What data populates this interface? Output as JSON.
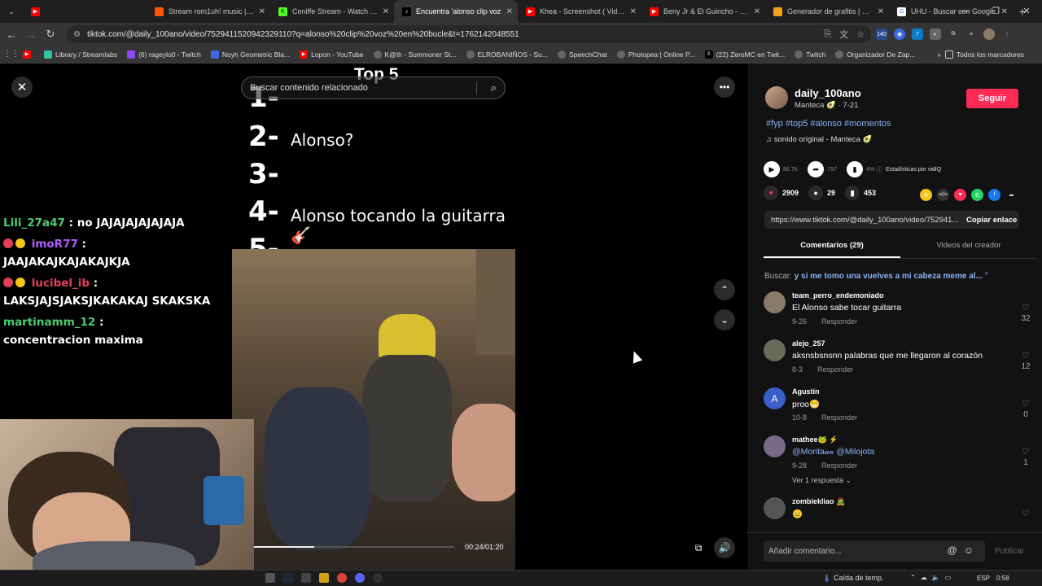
{
  "browser": {
    "tabs": [
      {
        "label": "Stream rom1uh! music | Listen",
        "color": "#ff5500"
      },
      {
        "label": "Ceniffe Stream - Watch Live on",
        "color": "#53fc18"
      },
      {
        "label": "Encuentra 'alonso clip voz",
        "color": "#000000"
      },
      {
        "label": "Khea - Screenshot ( Video Ofi",
        "color": "#ff0000"
      },
      {
        "label": "Beny Jr & El Guincho - Comba",
        "color": "#ff0000"
      },
      {
        "label": "Generador de grafitis | Genera",
        "color": "#f4a020"
      },
      {
        "label": "UHU - Buscar con Google",
        "color": "#4285f4"
      }
    ],
    "url": "tiktok.com/@daily_100ano/video/7529411520942329110?q=alonso%20clip%20voz%20en%20bucle&t=1762142048551",
    "bookmarks": [
      "Library / Streamlabs",
      "(6) rageylo0 - Twitch",
      "Noyh Geometric Bla...",
      "Lopon - YouTube",
      "K@th - Summoner St...",
      "ELROBANIÑOS - Su...",
      "SpeechChat",
      "Photopea | Online P...",
      "(22) ZeroMC en Twit...",
      "Twitch",
      "Organizador De Zap..."
    ],
    "all_bookmarks": "Todos los marcadores",
    "extension_badge": "140"
  },
  "chat": [
    {
      "user": "Lili_27a47",
      "color": "#4ecb71",
      "msg": "no JAJAJAJAJAJAJA",
      "badges": []
    },
    {
      "user": "imoR77",
      "color": "#b05cff",
      "msg": "JAAJAKAJKAJAKAJKJA",
      "badges": [
        "#f5c518"
      ]
    },
    {
      "user": "lucibel_ib",
      "color": "#e0415a",
      "msg": "LAKSJAJSJAKSJKAKAKAJ SKAKSKA",
      "badges": [
        "#f5c518"
      ]
    },
    {
      "user": "martinamm_12",
      "color": "#4ecb71",
      "msg": "concentracion maxima",
      "badges": []
    }
  ],
  "video": {
    "search_placeholder": "Buscar contenido relacionado",
    "title": "Top 5",
    "ranks": [
      {
        "n": "1-",
        "text": ""
      },
      {
        "n": "2-",
        "text": "Alonso?"
      },
      {
        "n": "3-",
        "text": ""
      },
      {
        "n": "4-",
        "text": "Alonso tocando la guitarra 🎸"
      },
      {
        "n": "5-",
        "text": ""
      }
    ],
    "time": "00:24/01:20",
    "progress": 0.3
  },
  "sidebar": {
    "author": "daily_100ano",
    "meta": "Manteca 🥑 · 7-21",
    "follow": "Seguir",
    "hashtags": "#fyp #top5 #alonso #momentos",
    "music": "♫  sonido original - Manteca 🥑",
    "plays": "86.7K",
    "shares": "797",
    "pct": "4%",
    "vidiq": "Estadísticas por vidIQ",
    "likes": "2909",
    "comments": "29",
    "saves": "453",
    "link": "https://www.tiktok.com/@daily_100ano/video/7529411520942329110",
    "copy": "Copiar enlace",
    "tab_comments": "Comentarios (29)",
    "tab_videos": "Videos del creador",
    "search_label": "Buscar:",
    "search_query": "y si me tomo una vuelves a mi cabeza meme al...",
    "comments_list": [
      {
        "name": "team_perro_endemoniado",
        "text": "El Alonso sabe tocar guitarra",
        "date": "9-26",
        "reply": "Responder",
        "likes": "32",
        "avatar": "#8a7a6a"
      },
      {
        "name": "alejo_257",
        "text": "aksnsbsnsnn palabras que me llegaron al corazón",
        "date": "8-3",
        "reply": "Responder",
        "likes": "12",
        "avatar": "#6a6a5a"
      },
      {
        "name": "Agustín",
        "text": "proo😁",
        "date": "10-8",
        "reply": "Responder",
        "likes": "0",
        "avatar": "#3a5fc8"
      },
      {
        "name": "mathee🐸 ⚡",
        "text": "@Morita𝒶𝒶 @Milojota",
        "date": "9-28",
        "reply": "Responder",
        "likes": "1",
        "avatar": "#7a6a8a",
        "more": "Ver 1 respuesta ⌄"
      },
      {
        "name": "zombiekliao 🧟",
        "text": "😐",
        "date": "",
        "reply": "",
        "likes": "",
        "avatar": "#555555"
      }
    ],
    "comment_placeholder": "Añadir comentario...",
    "post": "Publicar"
  },
  "taskbar": {
    "weather": "Caída de temp.",
    "lang": "ESP",
    "time": "0:58"
  }
}
